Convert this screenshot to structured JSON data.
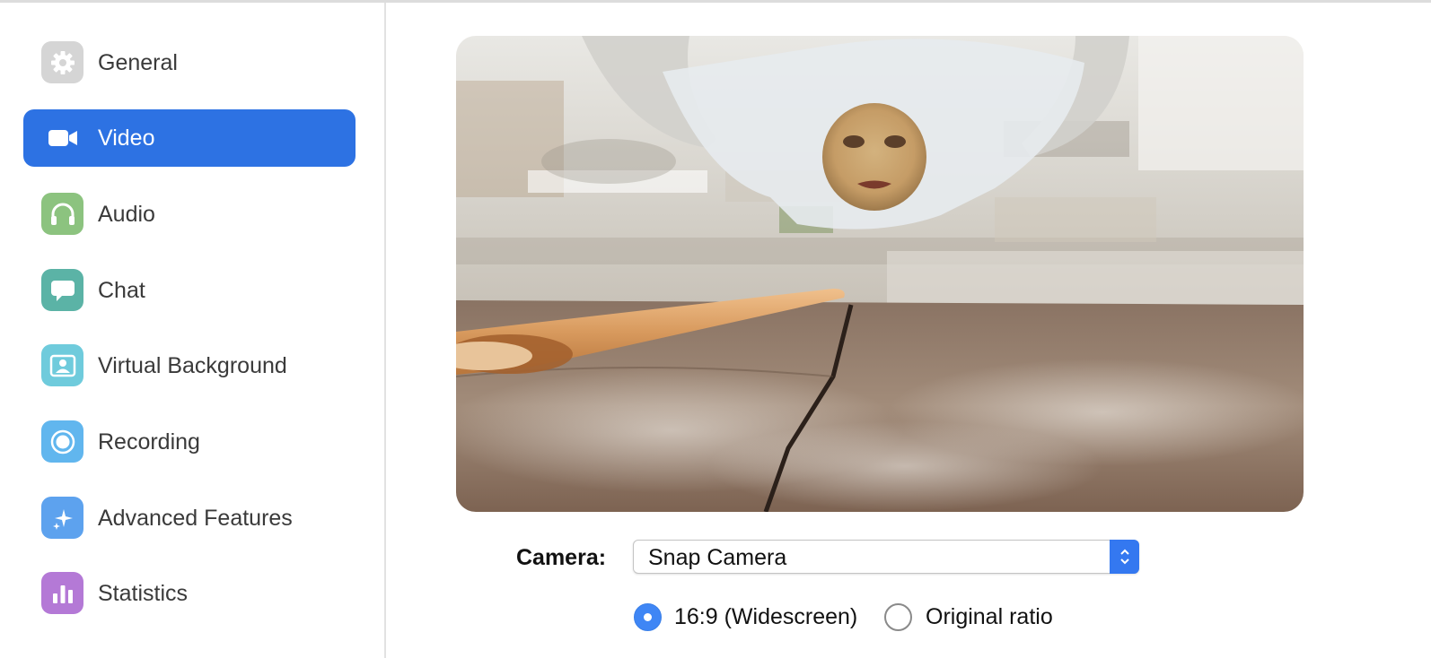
{
  "sidebar": {
    "items": [
      {
        "label": "General",
        "icon": "gear-icon",
        "color": "#d5d5d5",
        "active": false
      },
      {
        "label": "Video",
        "icon": "video-camera-icon",
        "color": "#2d72e3",
        "active": true
      },
      {
        "label": "Audio",
        "icon": "headphones-icon",
        "color": "#8cc37f",
        "active": false
      },
      {
        "label": "Chat",
        "icon": "chat-bubble-icon",
        "color": "#5bb3a6",
        "active": false
      },
      {
        "label": "Virtual Background",
        "icon": "portrait-icon",
        "color": "#6fcbdc",
        "active": false
      },
      {
        "label": "Recording",
        "icon": "record-icon",
        "color": "#61b6ee",
        "active": false
      },
      {
        "label": "Advanced Features",
        "icon": "sparkle-icon",
        "color": "#5da2ee",
        "active": false
      },
      {
        "label": "Statistics",
        "icon": "bar-chart-icon",
        "color": "#b479d6",
        "active": false
      }
    ]
  },
  "main": {
    "camera": {
      "label": "Camera:",
      "selected": "Snap Camera"
    },
    "aspect": {
      "options": [
        {
          "label": "16:9 (Widescreen)",
          "checked": true
        },
        {
          "label": "Original ratio",
          "checked": false
        }
      ]
    }
  },
  "colors": {
    "accent": "#2d72e3",
    "select_stepper": "#3478f0"
  }
}
